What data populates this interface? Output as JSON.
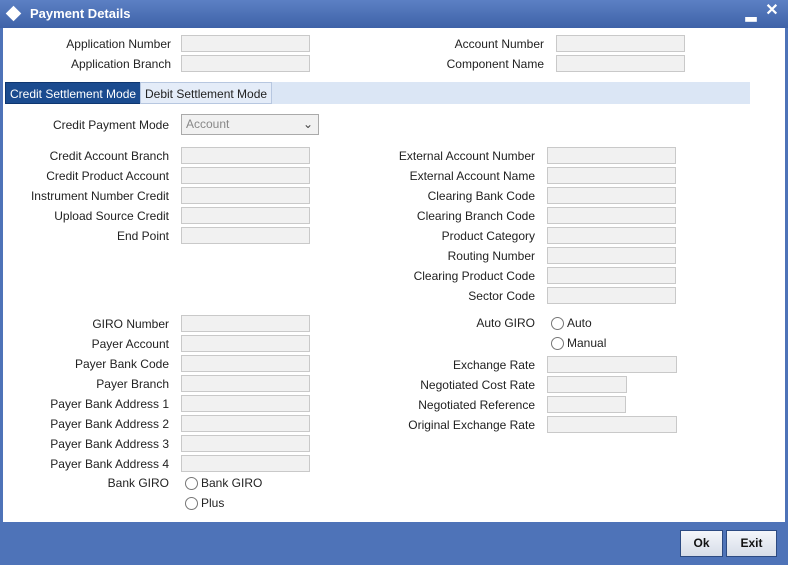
{
  "window": {
    "title": "Payment Details",
    "minimize_glyph": "▂",
    "close_glyph": "✕"
  },
  "header": {
    "application_number_label": "Application Number",
    "application_branch_label": "Application Branch",
    "account_number_label": "Account Number",
    "component_name_label": "Component Name"
  },
  "tabs": [
    {
      "label": "Credit Settlement Mode",
      "active": true
    },
    {
      "label": "Debit Settlement Mode",
      "active": false
    }
  ],
  "credit": {
    "payment_mode_label": "Credit Payment Mode",
    "payment_mode_value": "Account",
    "left_fields": [
      "Credit Account Branch",
      "Credit Product Account",
      "Instrument Number Credit",
      "Upload Source Credit",
      "End Point"
    ],
    "right_fields": [
      "External Account Number",
      "External Account Name",
      "Clearing Bank Code",
      "Clearing Branch Code",
      "Product Category",
      "Routing Number",
      "Clearing Product Code",
      "Sector Code"
    ]
  },
  "giro": {
    "left_fields": [
      "GIRO Number",
      "Payer Account",
      "Payer Bank Code",
      "Payer Branch",
      "Payer Bank Address 1",
      "Payer Bank Address 2",
      "Payer Bank Address 3",
      "Payer Bank Address 4"
    ],
    "bank_giro_label": "Bank GIRO",
    "bank_giro_options": [
      "Bank GIRO",
      "Plus"
    ],
    "auto_giro_label": "Auto GIRO",
    "auto_giro_options": [
      "Auto",
      "Manual"
    ],
    "right_fields": [
      "Exchange Rate",
      "Negotiated Cost Rate",
      "Negotiated Reference",
      "Original Exchange Rate"
    ]
  },
  "buttons": {
    "ok": "Ok",
    "exit": "Exit"
  }
}
